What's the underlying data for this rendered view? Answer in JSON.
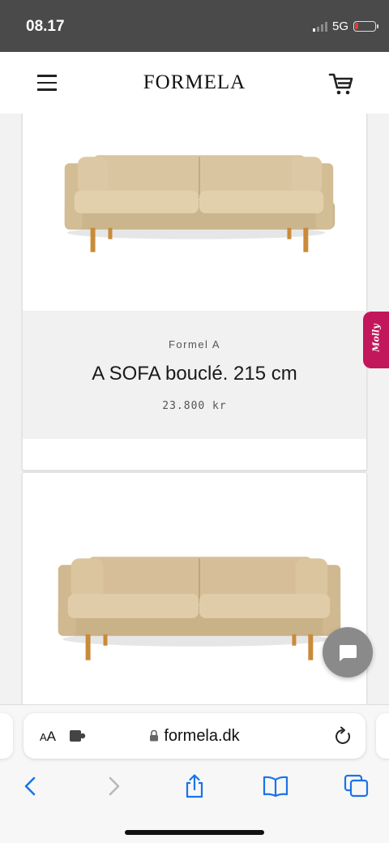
{
  "status_bar": {
    "time": "08.17",
    "network": "5G"
  },
  "header": {
    "logo": "FORMELA",
    "menu_icon": "hamburger-menu-icon",
    "cart_icon": "shopping-cart-icon"
  },
  "products": [
    {
      "brand": "Formel A",
      "name": "A SOFA bouclé. 215 cm",
      "price": "23.800 kr"
    }
  ],
  "molly_tab": {
    "label": "Molly"
  },
  "chat": {
    "icon": "chat-bubble-icon"
  },
  "browser": {
    "text_size_big": "A",
    "text_size_small": "A",
    "url": "formela.dk",
    "icons": [
      "extension-icon",
      "lock-icon",
      "reload-icon",
      "back-icon",
      "forward-icon",
      "share-icon",
      "bookmarks-icon",
      "tabs-icon"
    ]
  },
  "colors": {
    "accent": "#c2185b",
    "sofa": "#d8c39c",
    "sofa_legs": "#c98b3a",
    "browser_blue": "#1a73e8"
  }
}
